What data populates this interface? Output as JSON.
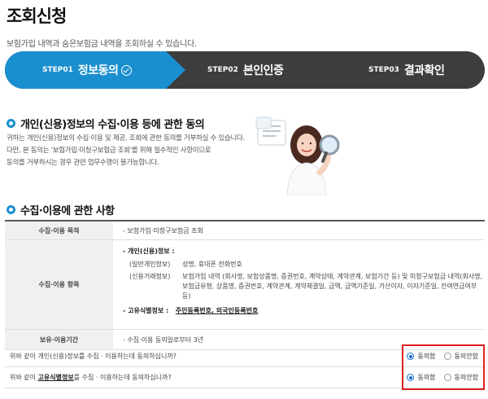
{
  "header": {
    "title": "조회신청",
    "description": "보험가입 내역과 숨은보험금 내역을 조회하실 수 있습니다."
  },
  "steps": [
    {
      "num": "STEP01",
      "label": "정보동의"
    },
    {
      "num": "STEP02",
      "label": "본인인증"
    },
    {
      "num": "STEP03",
      "label": "결과확인"
    }
  ],
  "section1": {
    "heading": "개인(신용)정보의 수집·이용 등에 관한 동의",
    "intro": [
      "귀하는 개인(신용)정보의 수집·이용 및 제공, 조회에 관한 동의를 거부하실 수 있습니다.",
      "다만, 본 동의는 '보험가입·미청구보험금 조회'를 위해 필수적인 사항이므로",
      "동의를 거부하시는 경우 관련 업무수행이 불가능합니다."
    ]
  },
  "section2": {
    "heading": "수집·이용에 관한 사항"
  },
  "table": {
    "purpose_label": "수집·이용 목적",
    "purpose_value": "- 보험가입·미청구보험금 조회",
    "items_label": "수집·이용 항목",
    "items_title": "- 개인(신용)정보 :",
    "general_key": "(일반개인정보)",
    "general_value": "성명, 휴대폰 전화번호",
    "credit_key": "(신용거래정보)",
    "credit_value": "보험가입 내역 (회사명, 보험상품명, 증권번호, 계약상태, 계약관계, 보험기간 등) 및 미청구보험금 내역(회사명, 보험금유형, 상품명, 증권번호, 계약관계, 계약체결일, 금액, 금액기준일, 가산이자, 이자기준일, 잔여연금여부 등)",
    "unique_key": "- 고유식별정보 :",
    "unique_value": "주민등록번호, 외국인등록번호",
    "retention_label": "보유·이용기간",
    "retention_value": "- 수집·이용 동의일로부터 3년"
  },
  "consents": [
    {
      "question": "위와 같이 개인(신용)정보를 수집 · 이용하는데 동의하십니까?",
      "agree": "동의함",
      "disagree": "동의안함",
      "selected": "agree"
    },
    {
      "question_pre": "위와 같이 ",
      "question_ul": "고유식별정보",
      "question_post": "를 수집 · 이용하는데 동의하십니까?",
      "agree": "동의함",
      "disagree": "동의안함",
      "selected": "agree"
    }
  ],
  "colors": {
    "accent": "#1a8fcf",
    "dark": "#3d3d3d",
    "highlight": "#e02020"
  },
  "icons": [
    "check-circle-icon",
    "section-bullet-icon",
    "magnifier-illustration"
  ]
}
